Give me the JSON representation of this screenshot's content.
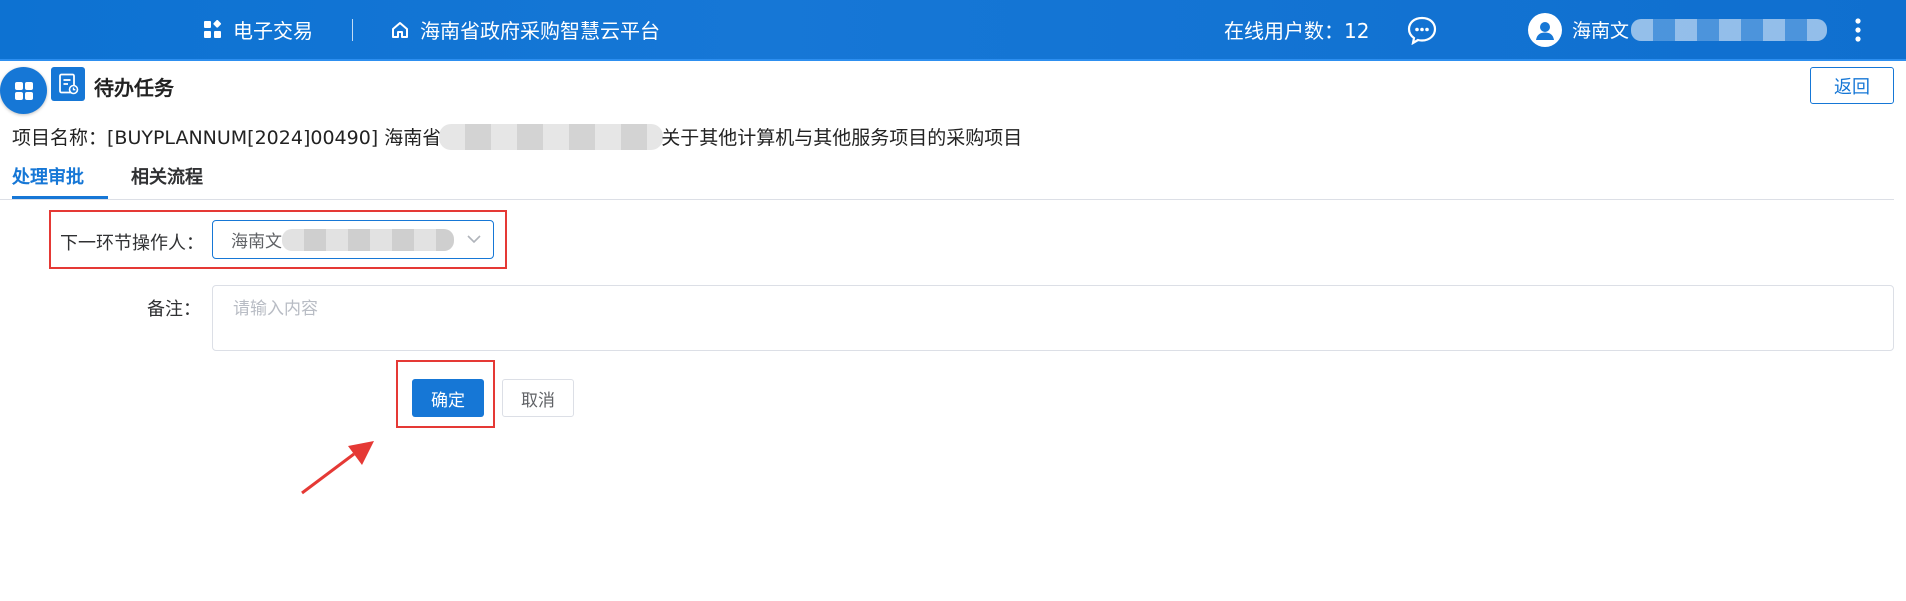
{
  "header": {
    "nav_trade": "电子交易",
    "nav_platform": "海南省政府采购智慧云平台",
    "online_users": "在线用户数：12",
    "user_name": "海南文"
  },
  "page": {
    "title": "待办任务",
    "back_label": "返回"
  },
  "project": {
    "label": "项目名称：",
    "code_and_prefix": "[BUYPLANNUM[2024]00490] 海南省",
    "suffix": "关于其他计算机与其他服务项目的采购项目"
  },
  "tabs": [
    {
      "label": "处理审批",
      "active": true
    },
    {
      "label": "相关流程",
      "active": false
    }
  ],
  "form": {
    "operator_label": "下一环节操作人：",
    "operator_value": "海南文",
    "remark_label": "备注：",
    "remark_placeholder": "请输入内容",
    "confirm_label": "确定",
    "cancel_label": "取消"
  },
  "colors": {
    "primary": "#1677d6",
    "highlight": "#e53935"
  }
}
